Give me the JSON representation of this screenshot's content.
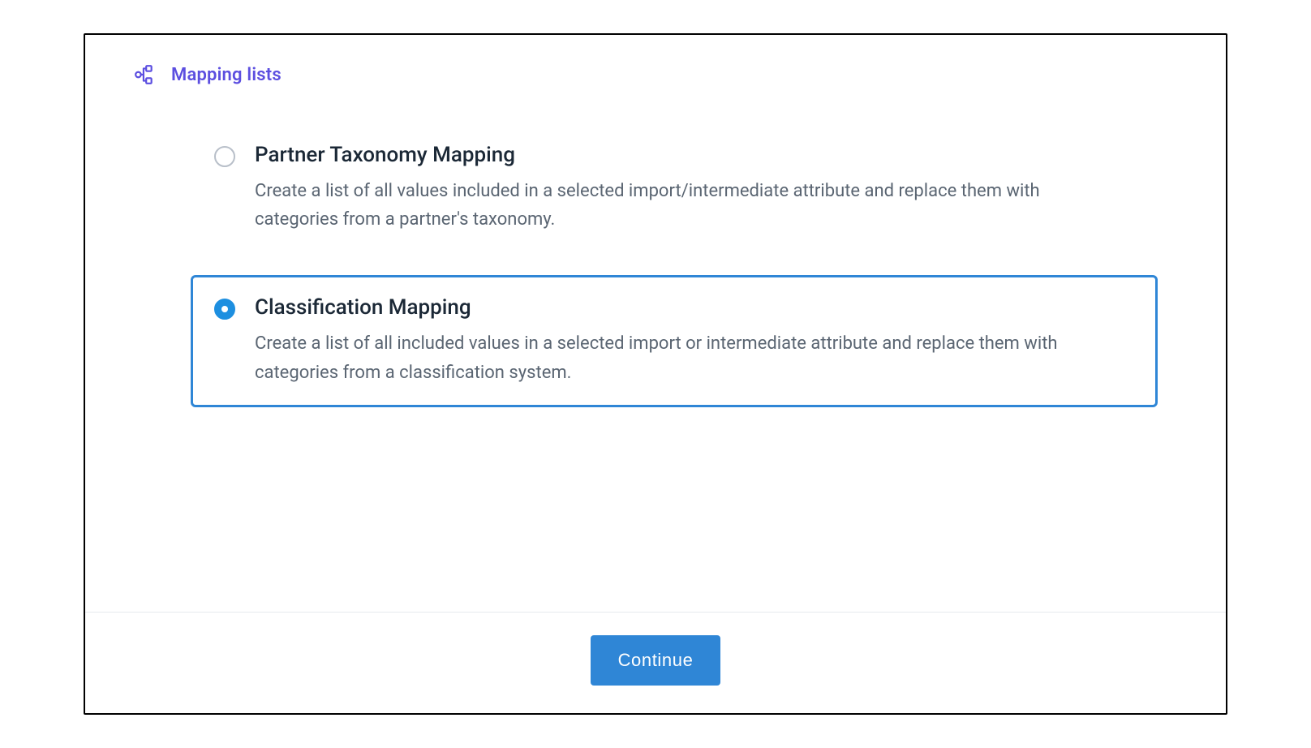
{
  "header": {
    "title": "Mapping lists",
    "icon": "hierarchy-icon",
    "accentColor": "#5c4fe0"
  },
  "options": [
    {
      "id": "partner-taxonomy",
      "title": "Partner Taxonomy Mapping",
      "description": "Create a list of all values included in a selected import/intermediate attribute and replace them with categories from a partner's taxonomy.",
      "selected": false
    },
    {
      "id": "classification",
      "title": "Classification Mapping",
      "description": "Create a list of all included values in a selected import or intermediate attribute and replace them with categories from a classification system.",
      "selected": true
    }
  ],
  "footer": {
    "continue_label": "Continue"
  },
  "colors": {
    "selectionBorder": "#2f86d6",
    "primaryButton": "#2f86d6",
    "radioSelected": "#1d8fe0"
  }
}
